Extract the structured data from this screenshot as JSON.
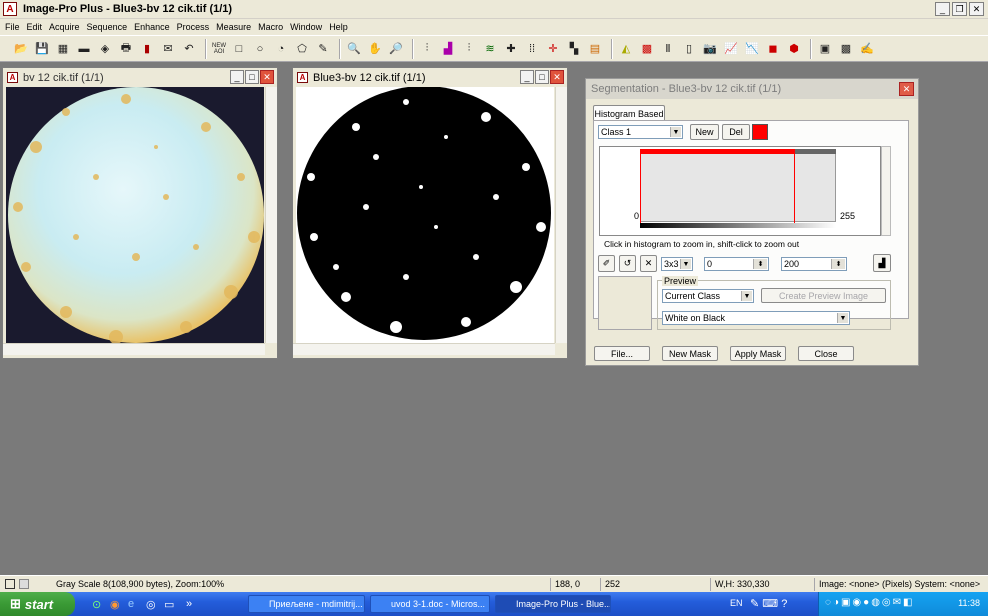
{
  "app": {
    "title": "Image-Pro Plus - Blue3-bv 12 cik.tif (1/1)",
    "logo_text": "A"
  },
  "menu": [
    "File",
    "Edit",
    "Acquire",
    "Sequence",
    "Enhance",
    "Process",
    "Measure",
    "Macro",
    "Window",
    "Help"
  ],
  "toolbar": {
    "new_aoi_label": "NEW AOI"
  },
  "windows": {
    "left": {
      "title": "bv 12 cik.tif (1/1)"
    },
    "middle": {
      "title": "Blue3-bv 12 cik.tif (1/1)"
    }
  },
  "segmentation": {
    "title": "Segmentation - Blue3-bv 12 cik.tif (1/1)",
    "tab": "Histogram Based",
    "class_select": "Class 1",
    "new_label": "New",
    "del_label": "Del",
    "class_color": "#ff0000",
    "hist_min_label": "0",
    "hist_max_label": "255",
    "hint": "Click in histogram to zoom in, shift-click to zoom out",
    "kernel_select": "3x3",
    "low_value": "0",
    "high_value": "200",
    "preview_group": "Preview",
    "preview_mode": "Current Class",
    "create_preview_label": "Create Preview Image",
    "display_mode": "White on Black",
    "file_label": "File...",
    "new_mask_label": "New Mask",
    "apply_mask_label": "Apply Mask",
    "close_label": "Close"
  },
  "status": {
    "info": "Gray Scale 8(108,900 bytes), Zoom:100%",
    "coords": "188,   0",
    "value": "252",
    "wh": "W,H: 330,330",
    "image": "Image: <none> (Pixels) System: <none>"
  },
  "taskbar": {
    "start": "start",
    "tasks": [
      "Приељене - mdimitrij...",
      "uvod 3-1.doc - Micros...",
      "Image-Pro Plus - Blue..."
    ],
    "lang": "EN",
    "clock": "11:38"
  }
}
